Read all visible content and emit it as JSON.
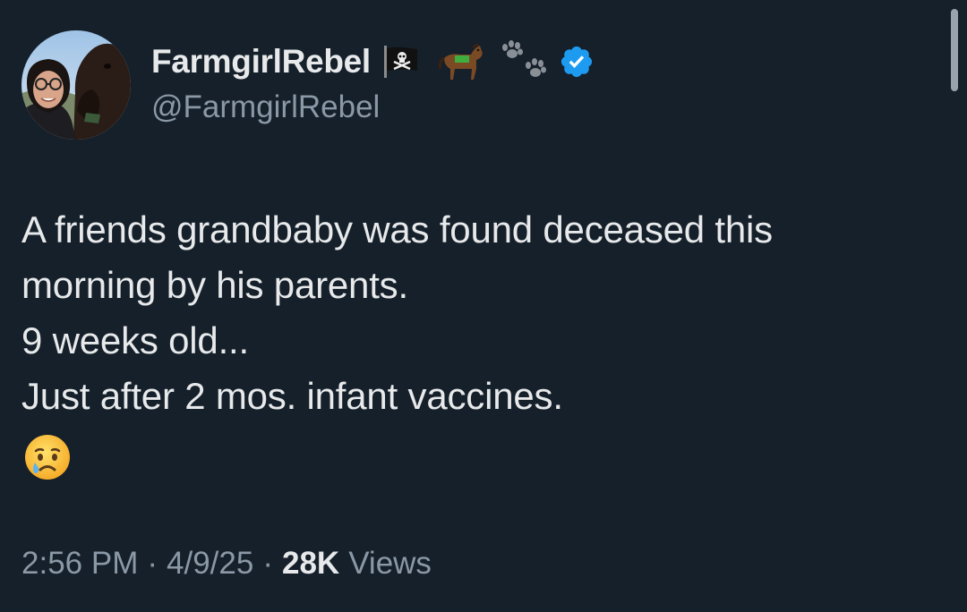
{
  "user": {
    "display_name": "FarmgirlRebel",
    "handle": "@FarmgirlRebel",
    "name_badges": [
      "pirate-flag-icon",
      "horse-icon",
      "paw-prints-icon",
      "verified-badge-icon"
    ]
  },
  "tweet": {
    "lines": [
      "A friends grandbaby was found deceased this",
      "morning by his parents.",
      "9 weeks old...",
      "Just after 2 mos. infant vaccines."
    ],
    "trailing_emoji": "crying-face-emoji"
  },
  "meta": {
    "time": "2:56 PM",
    "separator": "·",
    "date": "4/9/25",
    "views_count": "28K",
    "views_label": "Views"
  },
  "colors": {
    "background": "#15202b",
    "text_primary": "#e7e9ea",
    "text_secondary": "#8b98a5",
    "verified_blue": "#1d9bf0"
  }
}
